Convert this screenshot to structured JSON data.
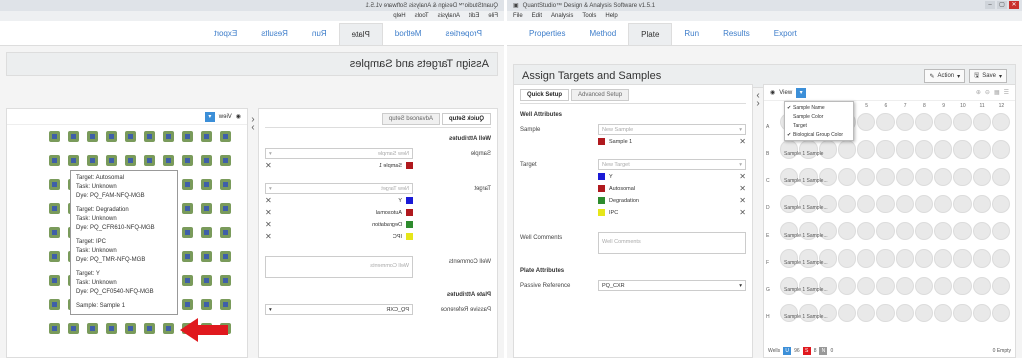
{
  "app_title": "QuantStudio™ Design & Analysis Software v1.5.1",
  "menu": [
    "File",
    "Edit",
    "Analysis",
    "Tools",
    "Help"
  ],
  "tabs": [
    "Properties",
    "Method",
    "Plate",
    "Run",
    "Results",
    "Export"
  ],
  "active_tab": "Plate",
  "header": {
    "title": "Assign Targets and Samples",
    "action": "Action",
    "save": "Save"
  },
  "setup": {
    "subtabs": [
      "Quick Setup",
      "Advanced Setup"
    ],
    "well_attributes": "Well Attributes",
    "sample_label": "Sample",
    "sample_placeholder": "New Sample",
    "samples": [
      {
        "name": "Sample 1",
        "color": "#b0191e"
      }
    ],
    "target_label": "Target",
    "target_placeholder": "New Target",
    "targets": [
      {
        "name": "Y",
        "color": "#1a1ad6"
      },
      {
        "name": "Autosomal",
        "color": "#b0191e"
      },
      {
        "name": "Degradation",
        "color": "#2e8b2e"
      },
      {
        "name": "IPC",
        "color": "#e6e61a"
      }
    ],
    "comments_label": "Well Comments",
    "comments_placeholder": "Well Comments",
    "plate_attributes": "Plate Attributes",
    "passive_label": "Passive Reference",
    "passive_value": "PQ_CXR"
  },
  "plate": {
    "view": "View",
    "columns": [
      "1",
      "2",
      "3",
      "4",
      "5",
      "6",
      "7",
      "8",
      "9",
      "10",
      "11",
      "12"
    ],
    "rows": [
      "A",
      "B",
      "C",
      "D",
      "E",
      "F",
      "G",
      "H"
    ],
    "row_labels": [
      "",
      "Sample 1 Sample",
      "Sample 1 Sample...",
      "Sample 1 Sample...",
      "Sample 1 Sample...",
      "Sample 1 Sample...",
      "Sample 1 Sample...",
      "Sample 1 Sample..."
    ],
    "view_menu": [
      "Sample Name",
      "Sample Color",
      "Target",
      "Biological Group Color"
    ],
    "view_checked": [
      true,
      false,
      false,
      true
    ],
    "legend": "Wells",
    "legend_counts": [
      "96",
      "8",
      "0"
    ],
    "empty": "0 Empty"
  },
  "tooltip": [
    {
      "target": "Target: Autosomal",
      "task": "Task: Unknown",
      "dye": "Dye: PQ_FAM-NFQ-MGB"
    },
    {
      "target": "Target: Degradation",
      "task": "Task: Unknown",
      "dye": "Dye: PQ_CFR610-NFQ-MGB"
    },
    {
      "target": "Target: IPC",
      "task": "Task: Unknown",
      "dye": "Dye: PQ_TMR-NFQ-MGB"
    },
    {
      "target": "Target: Y",
      "task": "Task: Unknown",
      "dye": "Dye: PQ_CF0540-NFQ-MGB"
    }
  ],
  "tooltip_sample": "Sample: Sample 1",
  "colors": {
    "accent": "#3c8fd8",
    "link": "#3d7dca",
    "well_green": "#7a9b5b",
    "arrow": "#e0191e"
  }
}
